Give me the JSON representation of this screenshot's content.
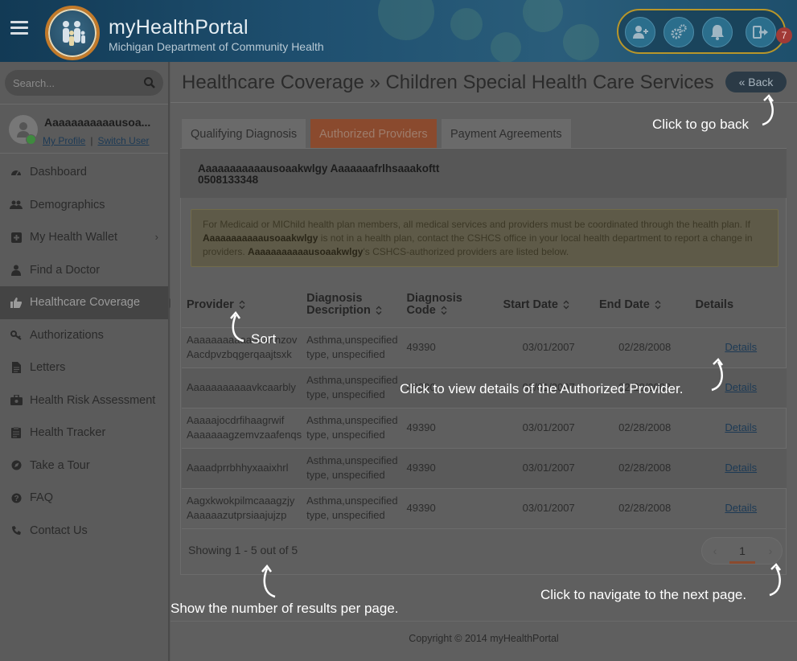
{
  "header": {
    "brand_title": "myHealthPortal",
    "brand_subtitle": "Michigan Department of Community Health",
    "notification_count": "7",
    "actions": [
      "add-user-icon",
      "gears-icon",
      "bell-icon",
      "logout-icon"
    ]
  },
  "sidebar": {
    "search_placeholder": "Search...",
    "user": {
      "name": "Aaaaaaaaaaausoa...",
      "my_profile": "My Profile",
      "separator": "|",
      "switch_user": "Switch User"
    },
    "items": [
      {
        "label": "Dashboard",
        "icon": "dashboard-icon"
      },
      {
        "label": "Demographics",
        "icon": "users-icon"
      },
      {
        "label": "My Health Wallet",
        "icon": "plus-square-icon",
        "chevron": "›"
      },
      {
        "label": "Find a Doctor",
        "icon": "doctor-icon"
      },
      {
        "label": "Healthcare Coverage",
        "icon": "thumbs-up-icon",
        "active": true
      },
      {
        "label": "Authorizations",
        "icon": "key-icon"
      },
      {
        "label": "Letters",
        "icon": "file-icon"
      },
      {
        "label": "Health Risk Assessment",
        "icon": "briefcase-icon"
      },
      {
        "label": "Health Tracker",
        "icon": "clipboard-icon"
      },
      {
        "label": "Take a Tour",
        "icon": "compass-icon"
      },
      {
        "label": "FAQ",
        "icon": "question-icon"
      },
      {
        "label": "Contact Us",
        "icon": "phone-icon"
      }
    ]
  },
  "main": {
    "title": "Healthcare Coverage » Children Special Health Care Services",
    "back_label": "« Back",
    "tabs": [
      {
        "label": "Qualifying Diagnosis"
      },
      {
        "label": "Authorized Providers",
        "active": true
      },
      {
        "label": "Payment Agreements"
      }
    ],
    "patient_name": "Aaaaaaaaaaausoaakwlgy Aaaaaaafrlhsaaakoftt",
    "patient_id": "0508133348",
    "alert": {
      "p1": "For Medicaid or MIChild health plan members, all medical services and providers must be coordinated through the health plan. If ",
      "name1": "Aaaaaaaaaaausoaakwlgy",
      "p2": " is not in a health plan, contact the CSHCS office in your local health department to report a change in providers. ",
      "name2": "Aaaaaaaaaaausoaakwlgy",
      "p3": "'s CSHCS-authorized providers are listed below."
    },
    "table": {
      "headers": {
        "provider": "Provider",
        "diag_desc_1": "Diagnosis",
        "diag_desc_2": "Description",
        "diag_code_1": "Diagnosis",
        "diag_code_2": "Code",
        "start": "Start Date",
        "end": "End Date",
        "details": "Details"
      },
      "rows": [
        {
          "provider_1": "Aaaaaaaaaaaaaahnzov",
          "provider_2": "Aacdpvzbqgerqaajtsxk",
          "desc_1": "Asthma,unspecified",
          "desc_2": "type, unspecified",
          "code": "49390",
          "start": "03/01/2007",
          "end": "02/28/2008",
          "details": "Details"
        },
        {
          "provider_1": "Aaaaaaaaaaavkcaarbly",
          "provider_2": "",
          "desc_1": "Asthma,unspecified",
          "desc_2": "type, unspecified",
          "code": "49390",
          "start": "03/01/2007",
          "end": "02/28/2008",
          "details": "Details"
        },
        {
          "provider_1": "Aaaaajocdrfihaagrwif",
          "provider_2": "Aaaaaaagzemvzaafenqs",
          "desc_1": "Asthma,unspecified",
          "desc_2": "type, unspecified",
          "code": "49390",
          "start": "03/01/2007",
          "end": "02/28/2008",
          "details": "Details"
        },
        {
          "provider_1": "Aaaadprrbhhyxaaixhrl",
          "provider_2": "",
          "desc_1": "Asthma,unspecified",
          "desc_2": "type, unspecified",
          "code": "49390",
          "start": "03/01/2007",
          "end": "02/28/2008",
          "details": "Details"
        },
        {
          "provider_1": "Aagxkwokpilmcaaagzjy",
          "provider_2": "Aaaaaazutprsiaajujzp",
          "desc_1": "Asthma,unspecified",
          "desc_2": "type, unspecified",
          "code": "49390",
          "start": "03/01/2007",
          "end": "02/28/2008",
          "details": "Details"
        }
      ]
    },
    "showing": "Showing 1 - 5 out of 5",
    "pager": {
      "prev": "‹",
      "page": "1",
      "next": "›"
    },
    "copyright": "Copyright © 2014 myHealthPortal"
  },
  "annotations": {
    "back": "Click to go back",
    "sort": "Sort",
    "details": "Click to view details of the Authorized Provider.",
    "results": "Show the number of results per page.",
    "next": "Click to navigate to the next page."
  },
  "colors": {
    "accent_active_tab": "#8a4a2e",
    "header_blue": "#1f5070",
    "badge_red": "#a13a36",
    "overlay_text": "#ffffff"
  }
}
